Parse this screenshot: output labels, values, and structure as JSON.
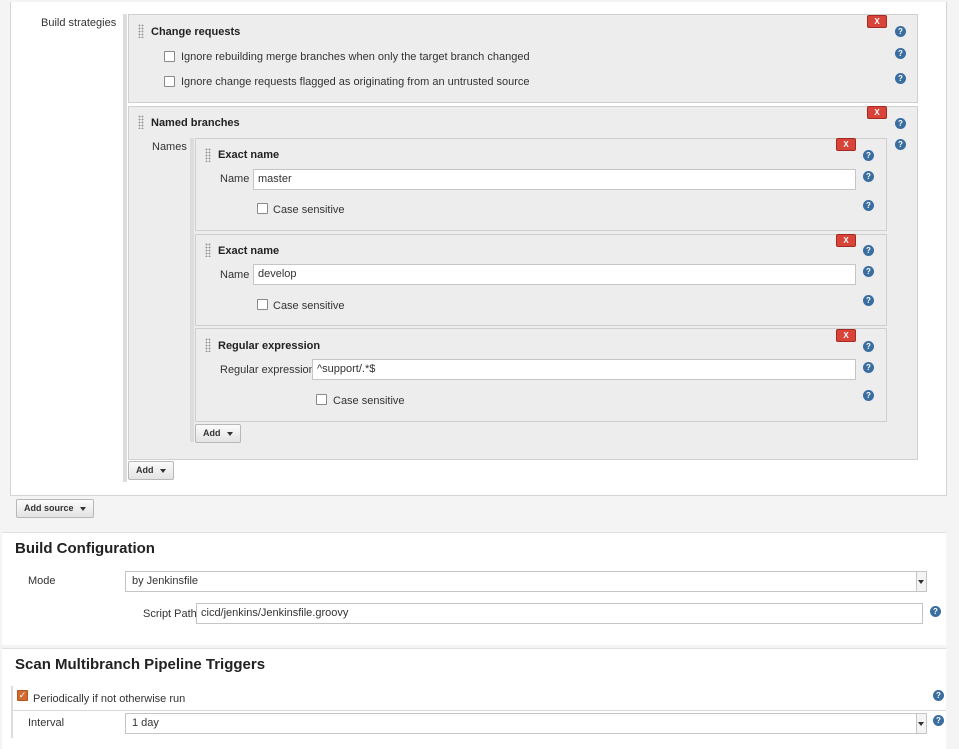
{
  "build_strategies": {
    "label": "Build strategies",
    "change_requests": {
      "title": "Change requests",
      "remove_label": "X",
      "options": [
        "Ignore rebuilding merge branches when only the target branch changed",
        "Ignore change requests flagged as originating from an untrusted source"
      ]
    },
    "named_branches": {
      "title": "Named branches",
      "remove_label": "X",
      "names_label": "Names",
      "exact_1": {
        "title": "Exact name",
        "remove_label": "X",
        "name_label": "Name",
        "name_value": "master",
        "case_label": "Case sensitive"
      },
      "exact_2": {
        "title": "Exact name",
        "remove_label": "X",
        "name_label": "Name",
        "name_value": "develop",
        "case_label": "Case sensitive"
      },
      "regex": {
        "title": "Regular expression",
        "remove_label": "X",
        "regex_label": "Regular expression",
        "regex_value": "^support/.*$",
        "case_label": "Case sensitive"
      },
      "add_label": "Add"
    },
    "add_label": "Add"
  },
  "add_source_label": "Add source",
  "build_configuration": {
    "title": "Build Configuration",
    "mode_label": "Mode",
    "mode_value": "by Jenkinsfile",
    "script_path_label": "Script Path",
    "script_path_value": "cicd/jenkins/Jenkinsfile.groovy"
  },
  "triggers": {
    "title": "Scan Multibranch Pipeline Triggers",
    "periodic_label": "Periodically if not otherwise run",
    "periodic_checked": true,
    "interval_label": "Interval",
    "interval_value": "1 day"
  },
  "icons": {
    "help": "?",
    "check": "✓"
  },
  "colors": {
    "remove_button": "#d9443a",
    "help_icon": "#3a6da0",
    "checkbox_checked": "#d36a2e"
  }
}
